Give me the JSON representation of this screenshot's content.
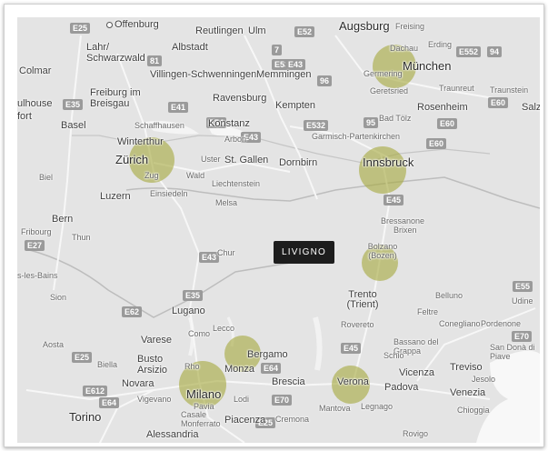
{
  "highlight_color": "#a5a83c",
  "pin_label": "LIVIGNO",
  "cities": [
    {
      "name": "Offenburg"
    },
    {
      "name": "Reutlingen"
    },
    {
      "name": "Ulm"
    },
    {
      "name": "Augsburg"
    },
    {
      "name": "Freising"
    },
    {
      "name": "Lahr/ Schwarzwald"
    },
    {
      "name": "Albstadt"
    },
    {
      "name": "Dachau"
    },
    {
      "name": "Erding"
    },
    {
      "name": "Colmar"
    },
    {
      "name": "Villingen-Schwenningen"
    },
    {
      "name": "Memmingen"
    },
    {
      "name": "Germering"
    },
    {
      "name": "München"
    },
    {
      "name": "Freiburg im Breisgau"
    },
    {
      "name": "Ravensburg"
    },
    {
      "name": "Kempten"
    },
    {
      "name": "Geretsried"
    },
    {
      "name": "Traunreut"
    },
    {
      "name": "Traunstein"
    },
    {
      "name": "ulhouse"
    },
    {
      "name": "fort"
    },
    {
      "name": "Basel"
    },
    {
      "name": "Schaffhausen"
    },
    {
      "name": "Konstanz"
    },
    {
      "name": "Bad Tölz"
    },
    {
      "name": "Rosenheim"
    },
    {
      "name": "Salz"
    },
    {
      "name": "Arbon"
    },
    {
      "name": "Garmisch-Partenkirchen"
    },
    {
      "name": "Winterthur"
    },
    {
      "name": "Zürich"
    },
    {
      "name": "Uster"
    },
    {
      "name": "St. Gallen"
    },
    {
      "name": "Dornbirn"
    },
    {
      "name": "Innsbruck"
    },
    {
      "name": "Zug"
    },
    {
      "name": "Wald"
    },
    {
      "name": "Biel"
    },
    {
      "name": "Luzern"
    },
    {
      "name": "Einsiedeln"
    },
    {
      "name": "Liechtenstein"
    },
    {
      "name": "Bern"
    },
    {
      "name": "Fribourg"
    },
    {
      "name": "Thun"
    },
    {
      "name": "Brixen"
    },
    {
      "name": "Bressanone"
    },
    {
      "name": "Bolzano (Bozen)"
    },
    {
      "name": "Chur"
    },
    {
      "name": "Melsa"
    },
    {
      "name": "s-les-Bains"
    },
    {
      "name": "Sion"
    },
    {
      "name": "Trento (Trient)"
    },
    {
      "name": "Belluno"
    },
    {
      "name": "Udine"
    },
    {
      "name": "Lugano"
    },
    {
      "name": "Feltre"
    },
    {
      "name": "Conegliano"
    },
    {
      "name": "Pordenone"
    },
    {
      "name": "Como"
    },
    {
      "name": "Lecco"
    },
    {
      "name": "Rovereto"
    },
    {
      "name": "Bassano del Grappa"
    },
    {
      "name": "San Donà di Piave"
    },
    {
      "name": "Aosta"
    },
    {
      "name": "Varese"
    },
    {
      "name": "Bergamo"
    },
    {
      "name": "Schio"
    },
    {
      "name": "Treviso"
    },
    {
      "name": "Busto Arsizio"
    },
    {
      "name": "Rho"
    },
    {
      "name": "Monza"
    },
    {
      "name": "Brescia"
    },
    {
      "name": "Vicenza"
    },
    {
      "name": "Jesolo"
    },
    {
      "name": "Biella"
    },
    {
      "name": "Novara"
    },
    {
      "name": "Milano"
    },
    {
      "name": "Verona"
    },
    {
      "name": "Padova"
    },
    {
      "name": "Venezia"
    },
    {
      "name": "Vigevano"
    },
    {
      "name": "Pavia"
    },
    {
      "name": "Lodi"
    },
    {
      "name": "Mantova"
    },
    {
      "name": "Legnago"
    },
    {
      "name": "Chioggia"
    },
    {
      "name": "Torino"
    },
    {
      "name": "Casale Monferrato"
    },
    {
      "name": "Alessandria"
    },
    {
      "name": "Piacenza"
    },
    {
      "name": "Cremona"
    },
    {
      "name": "Rovigo"
    }
  ],
  "roads": [
    "E25",
    "E52",
    "7",
    "E53",
    "E552",
    "94",
    "81",
    "E43",
    "96",
    "E41",
    "E60",
    "E35",
    "E532",
    "95",
    "E54",
    "E43",
    "E60",
    "E60",
    "E45",
    "E27",
    "E43",
    "E62",
    "E35",
    "E55",
    "E70",
    "E25",
    "E64",
    "E612",
    "E64",
    "E70",
    "E45",
    "E25"
  ],
  "highlights": [
    "München",
    "Zürich",
    "Innsbruck",
    "Bolzano",
    "Bergamo",
    "Milano",
    "Verona"
  ]
}
